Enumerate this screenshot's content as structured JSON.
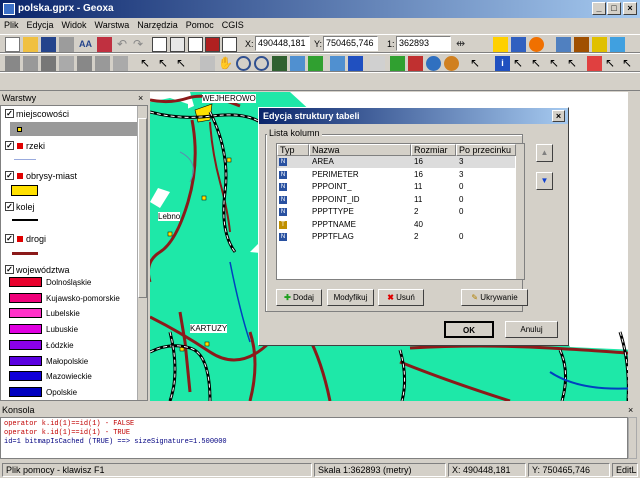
{
  "window": {
    "title": "polska.gprx - Geoxa",
    "minimize": "_",
    "maximize": "□",
    "close": "×"
  },
  "menu": [
    "Plik",
    "Edycja",
    "Widok",
    "Warstwa",
    "Narzędzia",
    "Pomoc",
    "CGIS"
  ],
  "coords": {
    "x_label": "X:",
    "x_value": "490448,181",
    "y_label": "Y:",
    "y_value": "750465,746",
    "scale_label": "1:",
    "scale_value": "362893"
  },
  "layers_panel": {
    "title": "Warstwy",
    "layers": [
      {
        "name": "miejscowości",
        "checked": true
      },
      {
        "name": "rzeki",
        "checked": true
      },
      {
        "name": "obrysy-miast",
        "checked": true
      },
      {
        "name": "kolej",
        "checked": true
      },
      {
        "name": "drogi",
        "checked": true
      },
      {
        "name": "województwa",
        "checked": true
      }
    ],
    "voivodeships": [
      {
        "name": "Dolnośląskie",
        "color": "#e8002c"
      },
      {
        "name": "Kujawsko-pomorskie",
        "color": "#f0007a"
      },
      {
        "name": "Lubelskie",
        "color": "#ff30c8"
      },
      {
        "name": "Lubuskie",
        "color": "#e000e0"
      },
      {
        "name": "Łódzkie",
        "color": "#8a00e8"
      },
      {
        "name": "Małopolskie",
        "color": "#5a00e0"
      },
      {
        "name": "Mazowieckie",
        "color": "#1000d8"
      },
      {
        "name": "Opolskie",
        "color": "#0000c0"
      }
    ]
  },
  "map": {
    "labels": [
      "WEJHEROWO",
      "Lebno",
      "KARTUZY"
    ]
  },
  "dialog": {
    "title": "Edycja struktury tabeli",
    "group_label": "Lista kolumn",
    "columns": [
      "Typ",
      "Nazwa",
      "Rozmiar",
      "Po przecinku"
    ],
    "rows": [
      {
        "type": "N",
        "name": "AREA",
        "size": "16",
        "decimals": "3"
      },
      {
        "type": "N",
        "name": "PERIMETER",
        "size": "16",
        "decimals": "3"
      },
      {
        "type": "N",
        "name": "PPPOINT_",
        "size": "11",
        "decimals": "0"
      },
      {
        "type": "N",
        "name": "PPPOINT_ID",
        "size": "11",
        "decimals": "0"
      },
      {
        "type": "N",
        "name": "PPPTTYPE",
        "size": "2",
        "decimals": "0"
      },
      {
        "type": "T",
        "name": "PPPTNAME",
        "size": "40",
        "decimals": ""
      },
      {
        "type": "N",
        "name": "PPPTFLAG",
        "size": "2",
        "decimals": "0"
      }
    ],
    "buttons": {
      "add": "Dodaj",
      "modify": "Modyfikuj",
      "delete": "Usuń",
      "hide": "Ukrywanie",
      "ok": "OK",
      "cancel": "Anuluj"
    }
  },
  "console": {
    "title": "Konsola",
    "lines": [
      {
        "text": "operator k.id(1)==id(1) - FALSE",
        "color": "#c00000"
      },
      {
        "text": "operator k.id(1)==id(1) - TRUE",
        "color": "#c00000"
      },
      {
        "text": "  id=1 bitmapIsCached (TRUE) ==> sizeSignature=1.500000",
        "color": "#000080"
      }
    ]
  },
  "statusbar": {
    "help": "Plik pomocy - klawisz F1",
    "scale": "Skala 1:362893 (metry)",
    "x": "X: 490448,181",
    "y": "Y: 750465,746",
    "mode": "EditL"
  }
}
